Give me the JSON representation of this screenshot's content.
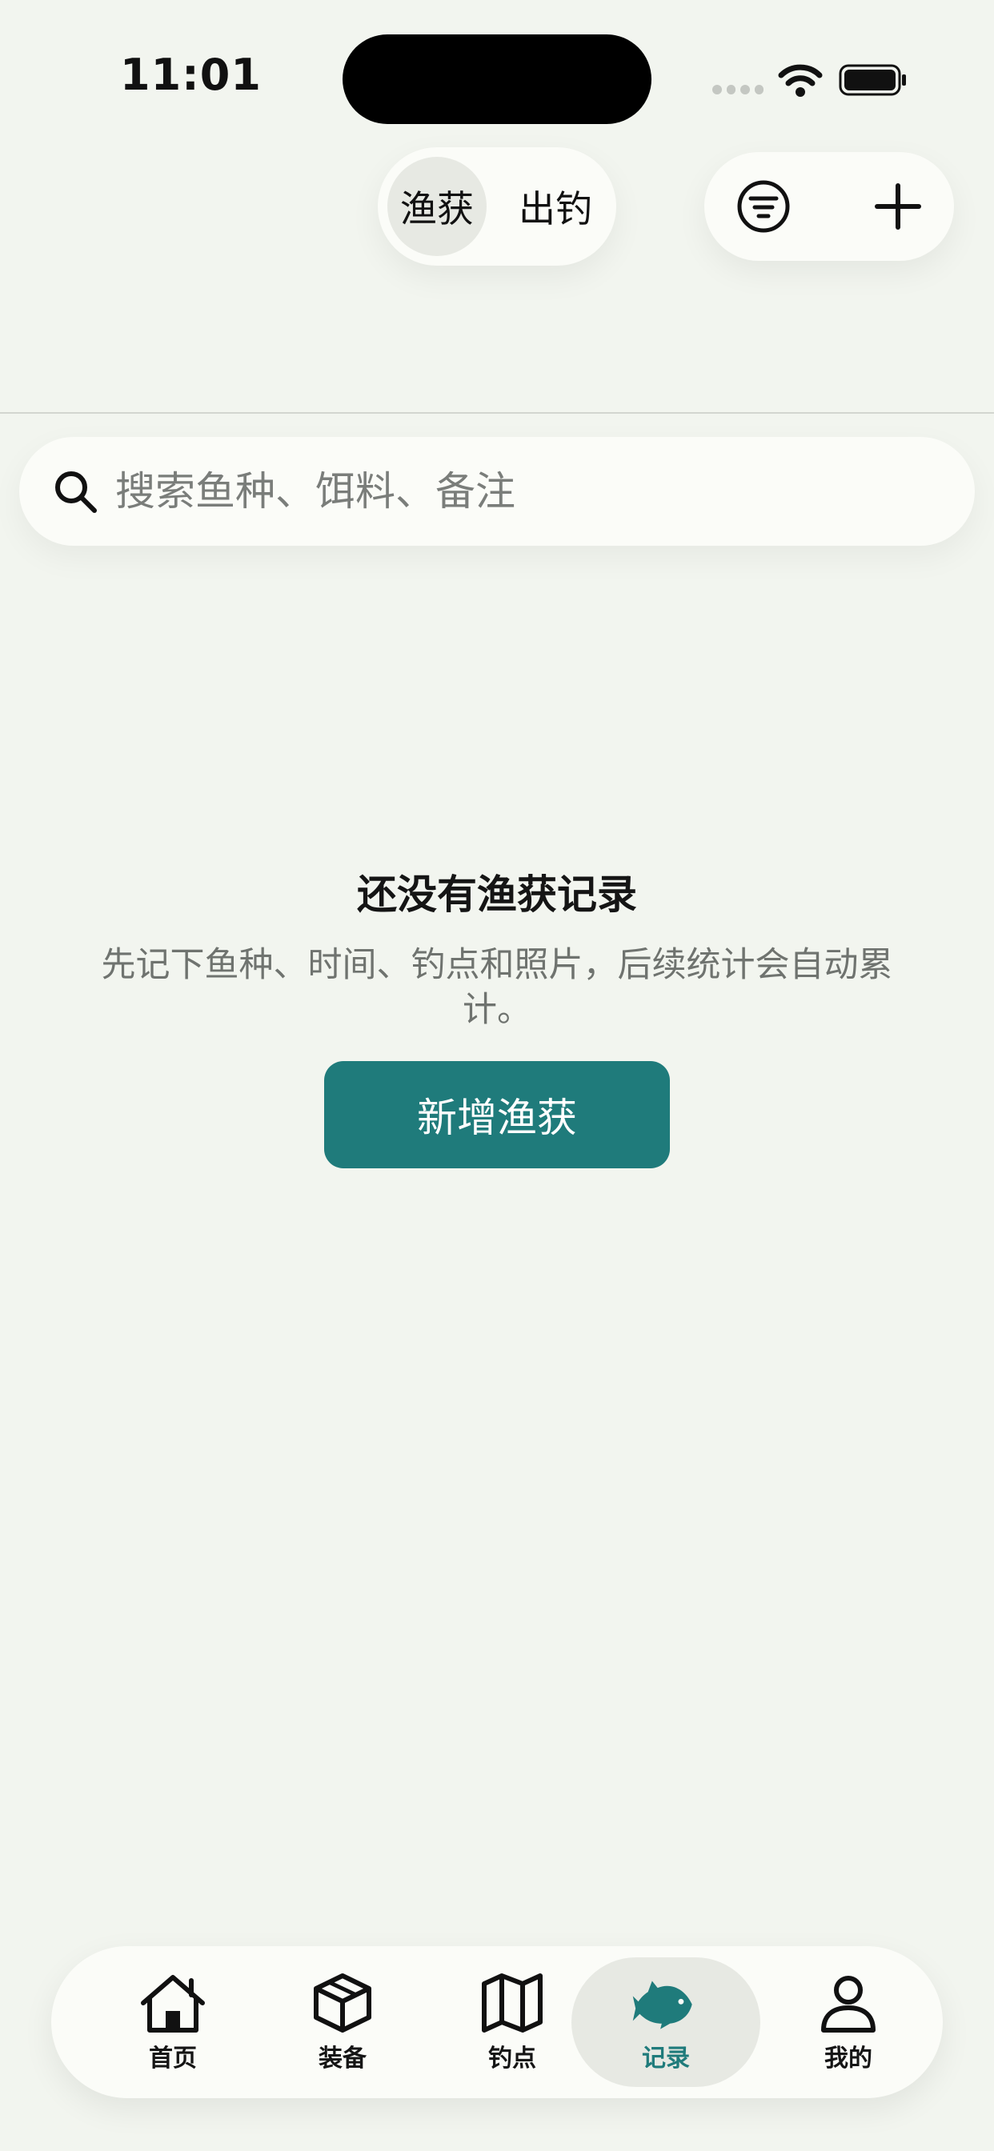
{
  "status_bar": {
    "time": "11:01"
  },
  "header": {
    "segments": [
      {
        "label": "渔获",
        "active": true
      },
      {
        "label": "出钓",
        "active": false
      }
    ],
    "filter_icon": "filter-icon",
    "add_icon": "plus-icon"
  },
  "search": {
    "placeholder": "搜索鱼种、饵料、备注",
    "value": ""
  },
  "empty_state": {
    "title": "还没有渔获记录",
    "description": "先记下鱼种、时间、钓点和照片，后续统计会自动累计。",
    "button_label": "新增渔获"
  },
  "tab_bar": {
    "items": [
      {
        "label": "首页",
        "icon": "home-icon",
        "active": false
      },
      {
        "label": "装备",
        "icon": "box-icon",
        "active": false
      },
      {
        "label": "钓点",
        "icon": "map-icon",
        "active": false
      },
      {
        "label": "记录",
        "icon": "fish-icon",
        "active": true
      },
      {
        "label": "我的",
        "icon": "person-icon",
        "active": false
      }
    ]
  },
  "colors": {
    "accent": "#1f7b7b",
    "background": "#f2f5ef",
    "surface": "#fbfcf8"
  }
}
